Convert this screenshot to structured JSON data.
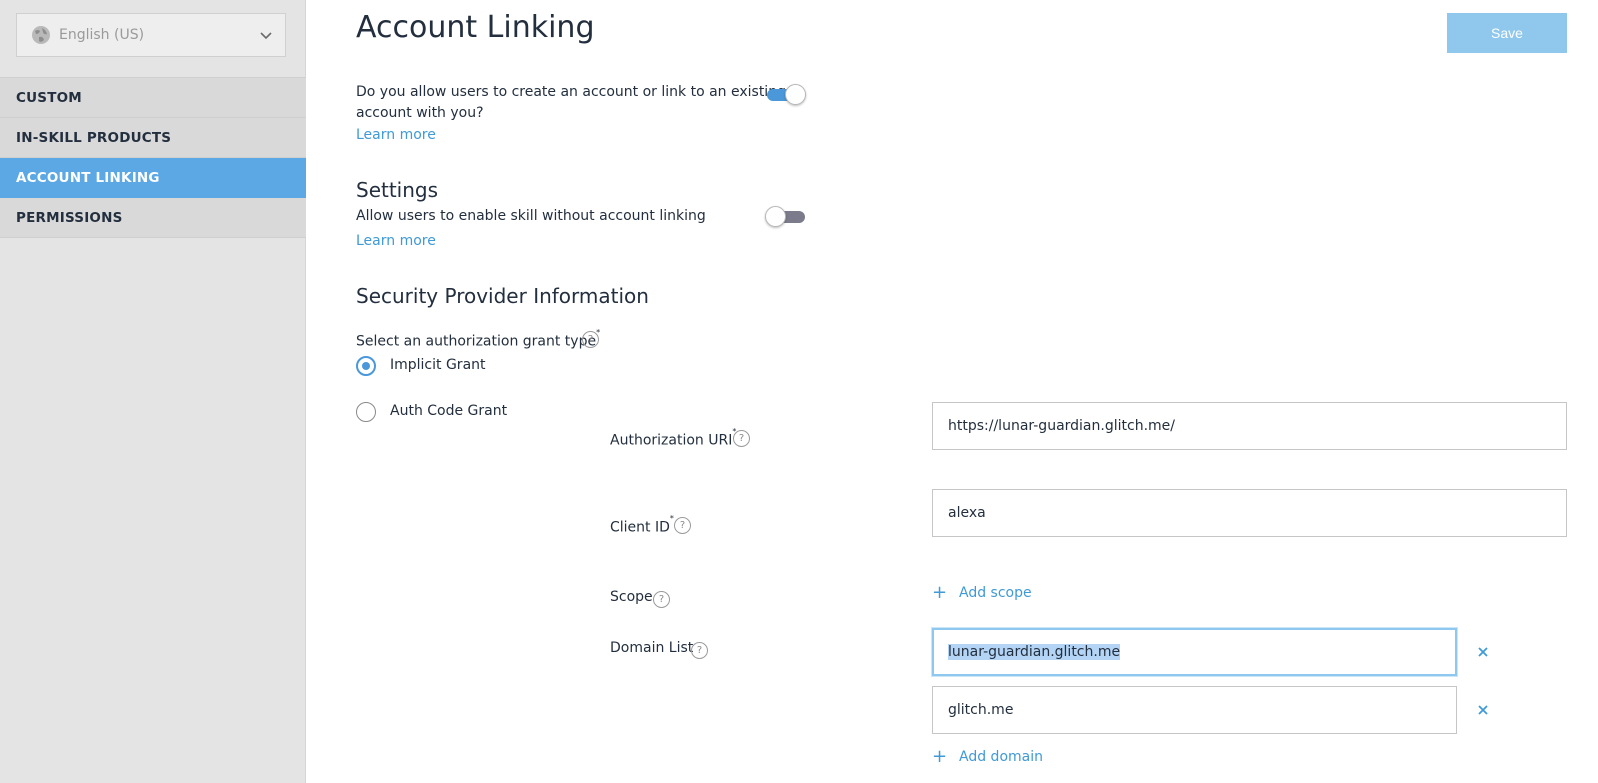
{
  "sidebar": {
    "language": "English (US)",
    "items": [
      {
        "label": "CUSTOM"
      },
      {
        "label": "IN-SKILL PRODUCTS"
      },
      {
        "label": "ACCOUNT LINKING"
      },
      {
        "label": "PERMISSIONS"
      }
    ],
    "active_index": 2
  },
  "header": {
    "title": "Account Linking",
    "save_label": "Save"
  },
  "account_linking": {
    "question_line1": "Do you allow users to create an account or link to an existing",
    "question_line2": "account with you?",
    "learn_more": "Learn more",
    "enabled": true
  },
  "settings": {
    "heading": "Settings",
    "allow_label": "Allow users to enable skill without account linking",
    "learn_more": "Learn more",
    "enabled": false
  },
  "security": {
    "heading": "Security Provider Information",
    "grant_type_label": "Select an authorization grant type",
    "required_mark": "*",
    "help_glyph": "?",
    "grant_options": [
      {
        "label": "Implicit Grant",
        "selected": true
      },
      {
        "label": "Auth Code Grant",
        "selected": false
      }
    ],
    "authorization_uri_label": "Authorization URI",
    "authorization_uri_value": "https://lunar-guardian.glitch.me/",
    "client_id_label": "Client ID",
    "client_id_value": "alexa",
    "scope_label": "Scope",
    "add_scope": "Add scope",
    "domain_list_label": "Domain List",
    "domains": [
      "lunar-guardian.glitch.me",
      "glitch.me"
    ],
    "add_domain": "Add domain",
    "plus_glyph": "+"
  },
  "colors": {
    "accent": "#5ca8e4",
    "link": "#3f9ad6",
    "save_button": "#8fc8ec",
    "sidebar_bg": "#e4e4e4"
  }
}
